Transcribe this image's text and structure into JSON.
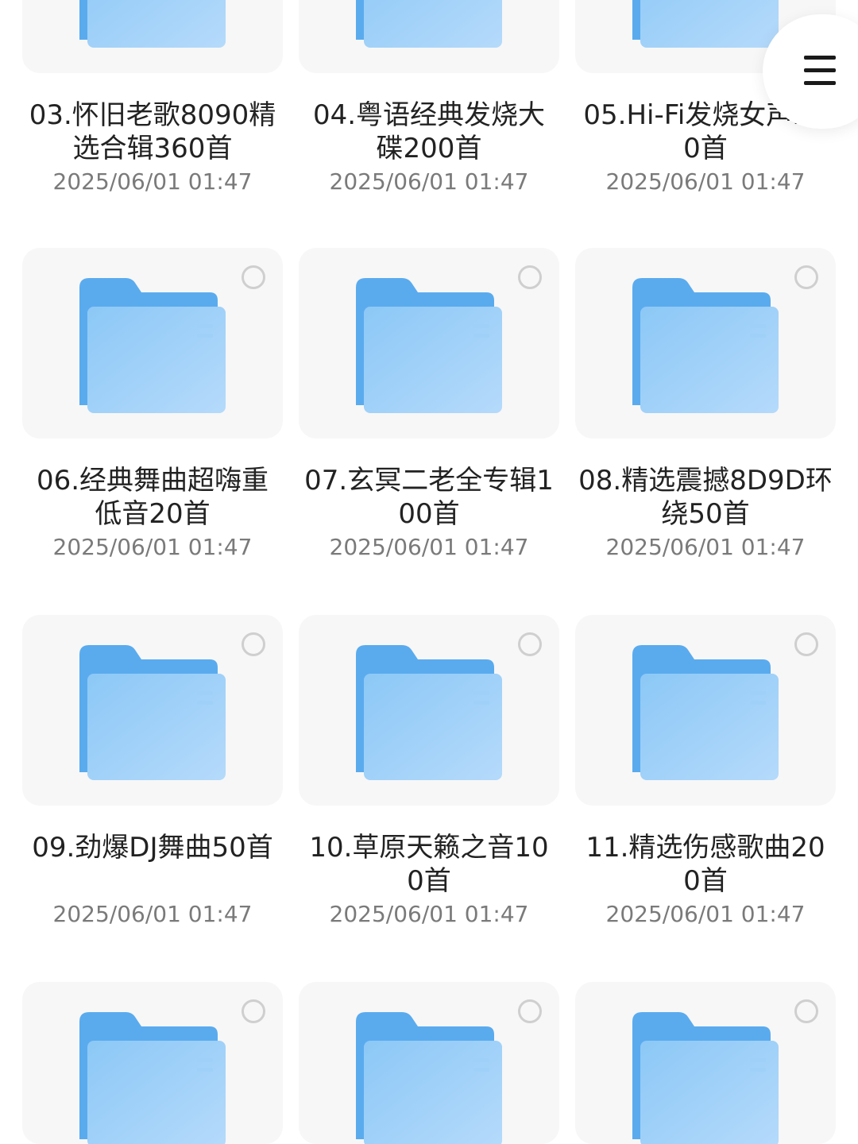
{
  "colors": {
    "folder_back": "#5aabee",
    "folder_front_top": "#8cc8f6",
    "folder_front_bottom": "#b5dafb",
    "card_bg": "#f7f7f7",
    "name_text": "#222222",
    "date_text": "#7a7a7a",
    "circle_border": "#cfcfcf"
  },
  "icons": {
    "folder": "folder-icon",
    "select": "select-circle-icon",
    "menu": "hamburger-menu-icon"
  },
  "folders": [
    {
      "name": "03.怀旧老歌8090精选合辑360首",
      "date": "2025/06/01 01:47"
    },
    {
      "name": "04.粤语经典发烧大碟200首",
      "date": "2025/06/01 01:47"
    },
    {
      "name": "05.Hi-Fi发烧女声200首",
      "date": "2025/06/01 01:47"
    },
    {
      "name": "06.经典舞曲超嗨重低音20首",
      "date": "2025/06/01 01:47"
    },
    {
      "name": "07.玄冥二老全专辑100首",
      "date": "2025/06/01 01:47"
    },
    {
      "name": "08.精选震撼8D9D环绕50首",
      "date": "2025/06/01 01:47"
    },
    {
      "name": "09.劲爆DJ舞曲50首",
      "date": "2025/06/01 01:47"
    },
    {
      "name": "10.草原天籁之音100首",
      "date": "2025/06/01 01:47"
    },
    {
      "name": "11.精选伤感歌曲200首",
      "date": "2025/06/01 01:47"
    },
    {
      "name": "",
      "date": ""
    },
    {
      "name": "",
      "date": ""
    },
    {
      "name": "",
      "date": ""
    }
  ]
}
